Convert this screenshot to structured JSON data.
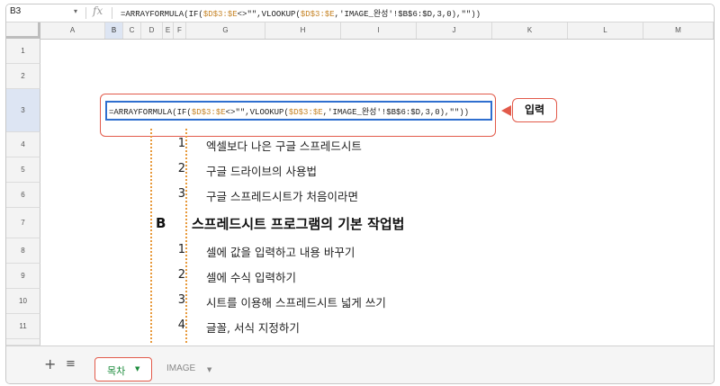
{
  "formula_bar": {
    "cell_ref": "B3",
    "fx": "fx",
    "formula_prefix": "=ARRAYFORMULA(IF(",
    "formula_ref1": "$D$3:$E",
    "formula_mid1": "<>\"\",VLOOKUP(",
    "formula_ref2": "$D$3:$E",
    "formula_mid2": ",'IMAGE_완성'!$B$6:$D,3,0),\"\"))"
  },
  "columns": [
    "A",
    "B",
    "C",
    "D",
    "E",
    "F",
    "G",
    "H",
    "I",
    "J",
    "K",
    "L",
    "M"
  ],
  "rows": [
    "1",
    "2",
    "3",
    "4",
    "5",
    "6",
    "7",
    "8",
    "9",
    "10",
    "11"
  ],
  "selected_cell": {
    "column": "B",
    "row": "3"
  },
  "input_cell": {
    "prefix": "=ARRAYFORMULA(IF(",
    "ref1": "$D$3:$E",
    "mid1": "<>\"\",VLOOKUP(",
    "ref2": "$D$3:$E",
    "mid2": ",'IMAGE_완성'!$B$6:$D,3,0),\"\"))"
  },
  "callout_label": "입력",
  "items_a": [
    {
      "num": "1",
      "text": "엑셀보다 나은 구글 스프레드시트"
    },
    {
      "num": "2",
      "text": "구글 드라이브의 사용법"
    },
    {
      "num": "3",
      "text": "구글 스프레드시트가 처음이라면"
    }
  ],
  "section_b": {
    "letter": "B",
    "title": "스프레드시트 프로그램의 기본 작업법"
  },
  "items_b": [
    {
      "num": "1",
      "text": "셀에 값을 입력하고 내용 바꾸기"
    },
    {
      "num": "2",
      "text": "셀에 수식 입력하기"
    },
    {
      "num": "3",
      "text": "시트를 이용해 스프레드시트 넓게 쓰기"
    },
    {
      "num": "4",
      "text": "글꼴, 서식 지정하기"
    }
  ],
  "sheet_tabs": {
    "add": "+",
    "list": "≡",
    "active": "목차",
    "other": "IMAGE",
    "caret": "▼"
  },
  "colors": {
    "highlight": "#e25a4a",
    "selection": "#2f6fcf",
    "tab_text": "#1a8a3a",
    "dotted": "#e89a3c"
  }
}
